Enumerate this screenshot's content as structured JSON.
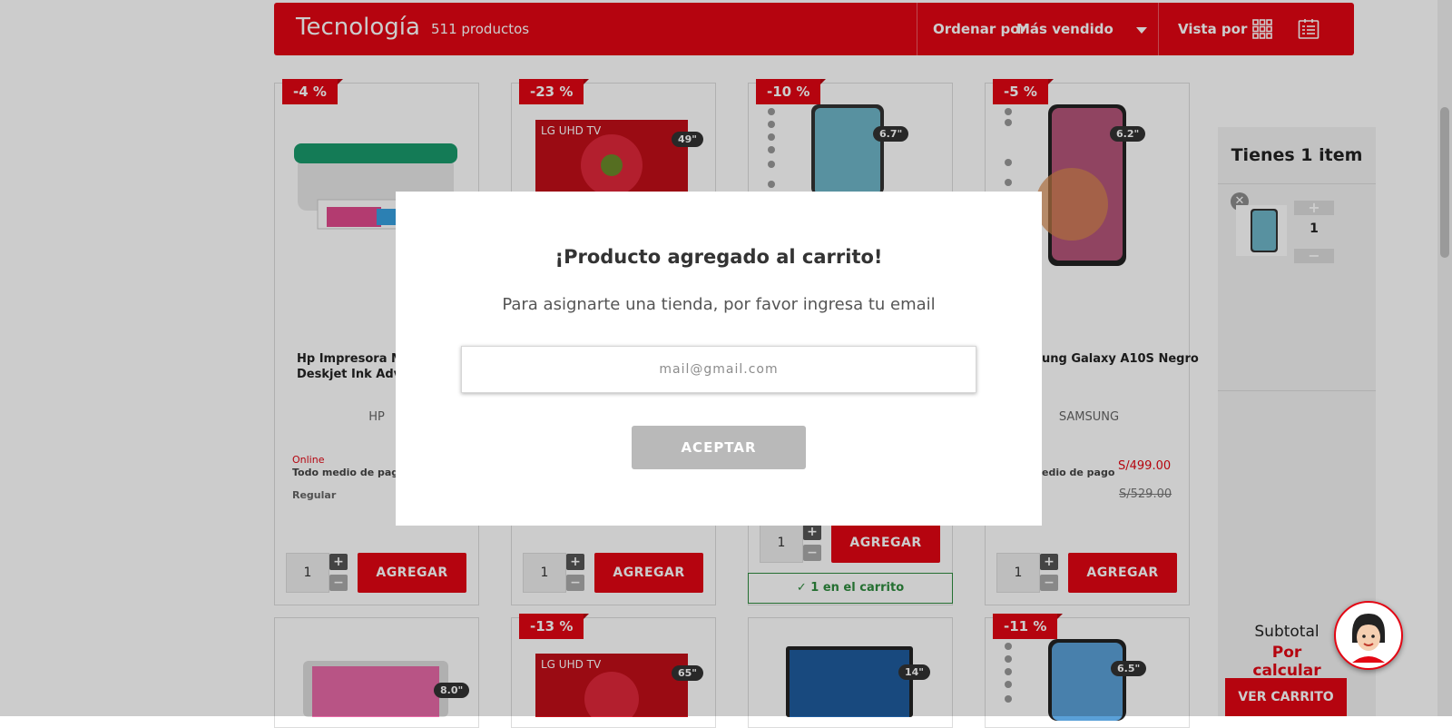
{
  "header": {
    "category_title": "Tecnología",
    "product_count": "511 productos",
    "sort_label": "Ordenar por",
    "sort_value": "Más vendido",
    "view_label": "Vista por"
  },
  "products_row1": [
    {
      "discount": "-4 %",
      "name": "Hp Impresora Mul",
      "name_line2": "Deskjet Ink Advan",
      "brand": "HP",
      "channel": "Online",
      "payment": "Todo medio de pago",
      "regular_label": "Regular",
      "qty": "1",
      "add_label": "AGREGAR"
    },
    {
      "discount": "-23 %",
      "size": "49\"",
      "qty": "1",
      "add_label": "AGREGAR"
    },
    {
      "discount": "-10 %",
      "size": "6.7\"",
      "qty": "1",
      "add_label": "AGREGAR",
      "in_cart": "1 en el carrito"
    },
    {
      "discount": "-5 %",
      "size": "6.2\"",
      "name": "ung Galaxy A10S Negro",
      "brand": "SAMSUNG",
      "payment": "edio de pago",
      "price": "S/499.00",
      "old_price": "S/529.00",
      "qty": "1",
      "add_label": "AGREGAR"
    }
  ],
  "products_row2": [
    {
      "size": "8.0\""
    },
    {
      "discount": "-13 %",
      "size": "65\""
    },
    {
      "size": "14\""
    },
    {
      "discount": "-11 %",
      "size": "6.5\""
    }
  ],
  "cart": {
    "title": "Tienes 1 item",
    "item_qty": "1",
    "subtotal_label": "Subtotal",
    "subtotal_value": "Por calcular",
    "view_cart_label": "VER CARRITO"
  },
  "modal": {
    "title": "¡Producto agregado al carrito!",
    "subtitle": "Para asignarte una tienda, por favor ingresa tu email",
    "email_placeholder": "mail@gmail.com",
    "accept_label": "ACEPTAR"
  },
  "colors": {
    "brand_red": "#e30613",
    "success_green": "#2e8b3e",
    "disabled_gray": "#b9b9b9"
  }
}
